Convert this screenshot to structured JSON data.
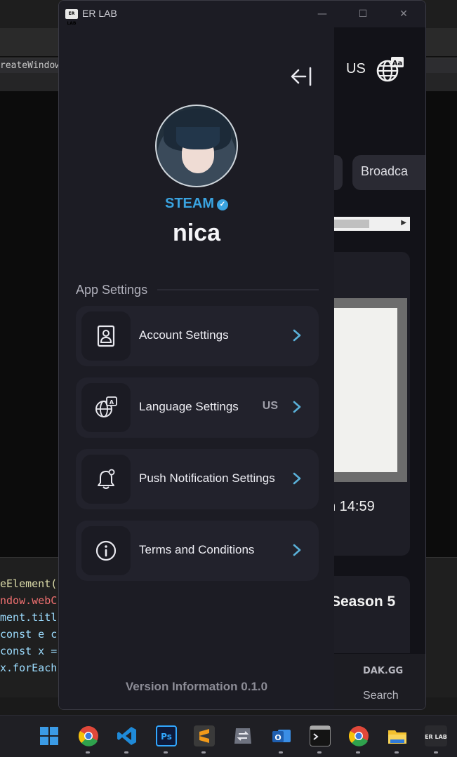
{
  "background": {
    "tab_text": "reateWindow",
    "code_lines": [
      {
        "text": "eElement(",
        "color": "#dcdcaa"
      },
      {
        "text": "ndow.webC",
        "color": "#f07070"
      },
      {
        "text": "ment.titl",
        "color": "#9cdcfe"
      },
      {
        "text": "const e c",
        "color": "#9cdcfe"
      },
      {
        "text": "const x =",
        "color": "#9cdcfe"
      },
      {
        "text": "x.forEach",
        "color": "#9cdcfe"
      }
    ]
  },
  "window": {
    "logo_text": "ER LAB",
    "title": "ER LAB",
    "minimize_glyph": "—",
    "maximize_glyph": "☐",
    "close_glyph": "✕"
  },
  "page_behind": {
    "region_code": "US",
    "globe_icon": "globe-language-icon",
    "chip_label": "Broadca",
    "card_time": "n 14:59",
    "card2_title": "Season 5",
    "nav_logo": "DAK.GG",
    "nav_search_label": "Search"
  },
  "drawer": {
    "collapse_icon": "collapse-left-icon",
    "platform": "STEAM",
    "verified_icon": "verified-badge-icon",
    "verified_glyph": "✓",
    "username": "nica",
    "section_title": "App Settings",
    "menu": [
      {
        "id": "account",
        "label": "Account Settings",
        "value": "",
        "icon": "user-card-icon"
      },
      {
        "id": "language",
        "label": "Language Settings",
        "value": "US",
        "icon": "globe-language-icon"
      },
      {
        "id": "push",
        "label": "Push Notification Settings",
        "value": "",
        "icon": "bell-icon"
      },
      {
        "id": "terms",
        "label": "Terms and Conditions",
        "value": "",
        "icon": "info-icon"
      }
    ],
    "version": "Version Information 0.1.0",
    "accent_color": "#3aa3e0",
    "chevron_color": "#5ab0d8"
  },
  "taskbar": {
    "items": [
      {
        "name": "windows-start-icon",
        "color": "#3b9be6"
      },
      {
        "name": "chrome-icon",
        "color": "#e0483a"
      },
      {
        "name": "vscode-icon",
        "color": "#1f8ad8"
      },
      {
        "name": "photoshop-icon",
        "color": "#1b2a5a"
      },
      {
        "name": "sublime-icon",
        "color": "#f29a1a"
      },
      {
        "name": "transfer-icon",
        "color": "#6f7380"
      },
      {
        "name": "outlook-icon",
        "color": "#1f6fd0"
      },
      {
        "name": "terminal-icon",
        "color": "#2e2e2e"
      },
      {
        "name": "chrome-icon",
        "color": "#e0483a"
      },
      {
        "name": "file-explorer-icon",
        "color": "#f2c12e"
      },
      {
        "name": "erlab-app-icon",
        "color": "#2a2a2e"
      }
    ],
    "erlab_label": "ER LAB"
  }
}
